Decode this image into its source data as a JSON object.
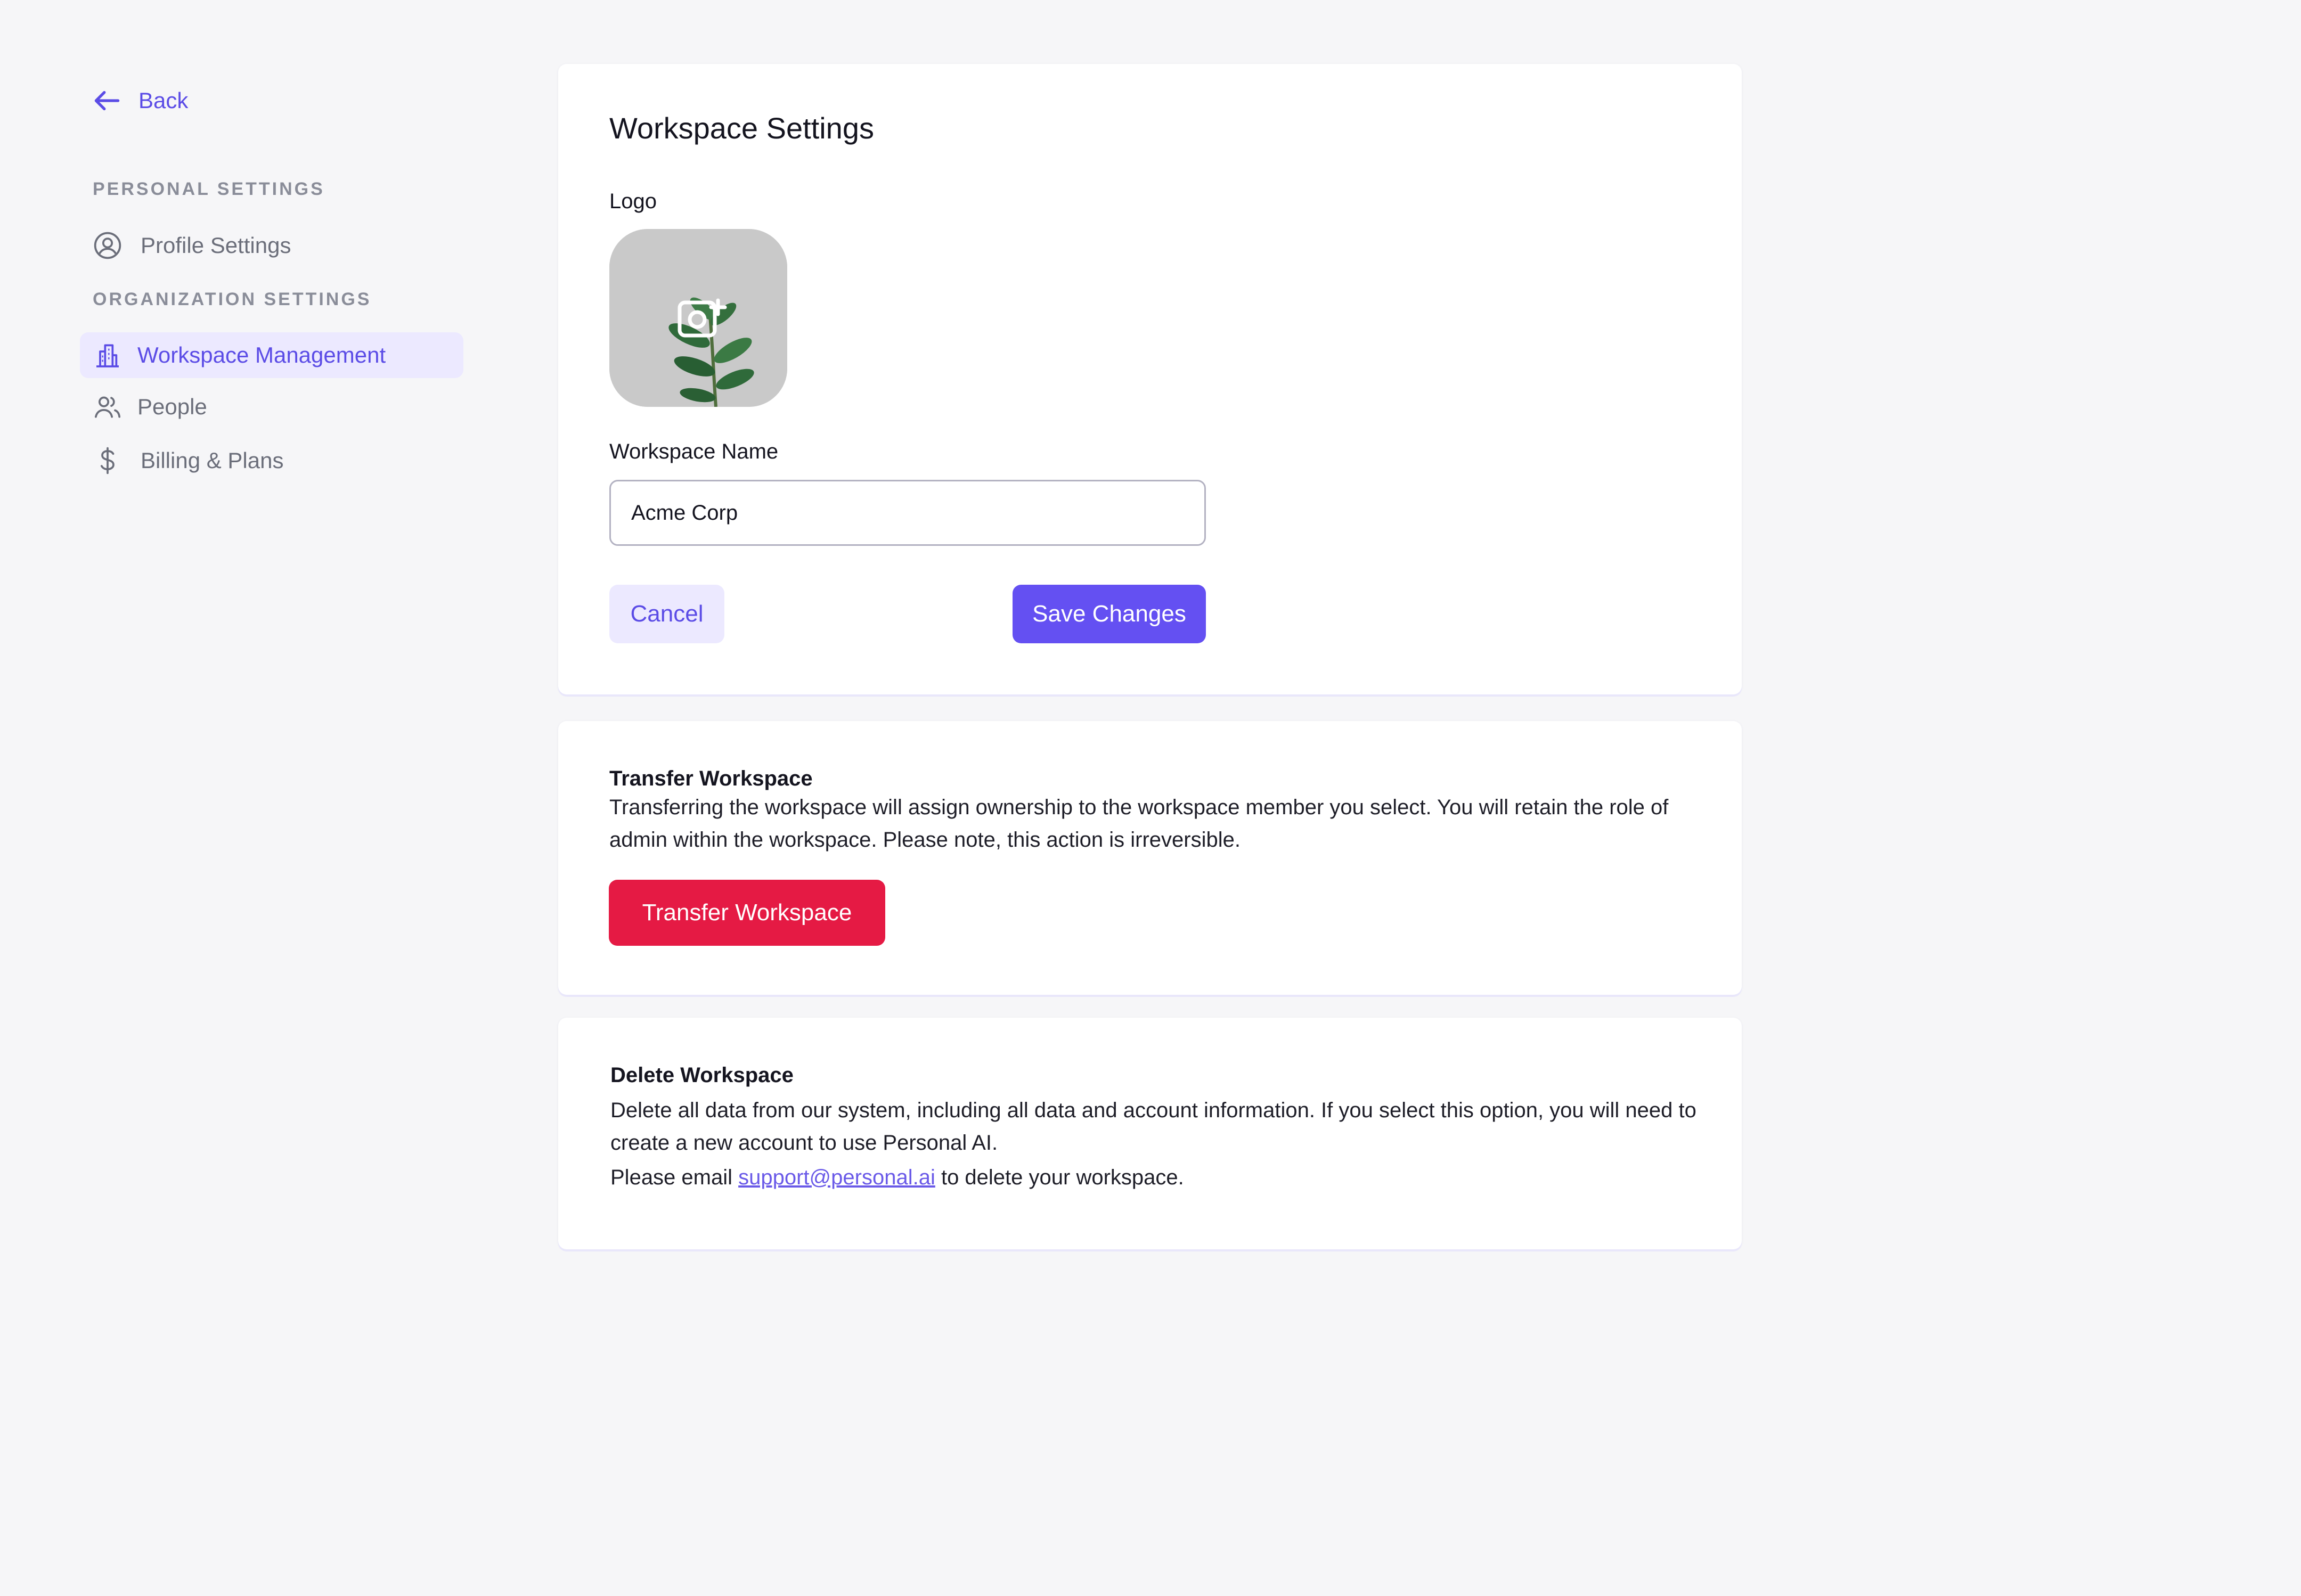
{
  "sidebar": {
    "back_label": "Back",
    "personal_heading": "PERSONAL SETTINGS",
    "org_heading": "ORGANIZATION SETTINGS",
    "items": [
      {
        "label": "Profile Settings",
        "icon": "user-circle-icon"
      },
      {
        "label": "Workspace Management",
        "icon": "building-icon",
        "active": true
      },
      {
        "label": "People",
        "icon": "users-icon"
      },
      {
        "label": "Billing & Plans",
        "icon": "dollar-icon"
      }
    ]
  },
  "workspace_settings": {
    "title": "Workspace Settings",
    "logo_label": "Logo",
    "name_label": "Workspace Name",
    "name_value": "Acme Corp",
    "cancel_label": "Cancel",
    "save_label": "Save Changes"
  },
  "transfer": {
    "title": "Transfer Workspace",
    "description": "Transferring the workspace will assign ownership to the workspace member you select. You will retain the role of admin within the workspace. Please note, this action is irreversible.",
    "button_label": "Transfer Workspace"
  },
  "delete": {
    "title": "Delete Workspace",
    "description": "Delete all data from our system, including all data and account information. If you select this option, you will need to create a new account to use Personal AI.",
    "email_prefix": "Please email ",
    "email": "support@personal.ai",
    "email_suffix": " to delete your workspace."
  },
  "colors": {
    "accent": "#5b4ce6",
    "primary_button": "#6450f2",
    "danger": "#e51a44",
    "active_bg": "#ece9ff",
    "page_bg": "#f6f6f8"
  }
}
